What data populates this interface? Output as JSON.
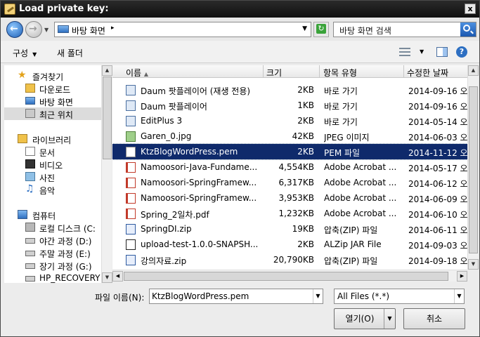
{
  "window": {
    "title": "Load private key:",
    "close_label": "x"
  },
  "address": {
    "path": "바탕 화면",
    "separator": "▸",
    "search_placeholder": "바탕 화면 검색"
  },
  "toolbar": {
    "organize": "구성",
    "new_folder": "새 폴더"
  },
  "nav": {
    "favorites": "즐겨찾기",
    "downloads": "다운로드",
    "desktop": "바탕 화면",
    "recent": "최근 위치",
    "libraries": "라이브러리",
    "documents": "문서",
    "videos": "비디오",
    "pictures": "사진",
    "music": "음악",
    "computer": "컴퓨터",
    "local_disk": "로컬 디스크 (C:",
    "drive_d": "야간 과정 (D:)",
    "drive_e": "주말 과정 (E:)",
    "drive_g": "장기 과정 (G:)",
    "drive_hp": "HP_RECOVERY"
  },
  "columns": {
    "name": "이름",
    "size": "크기",
    "type": "항목 유형",
    "date": "수정한 날짜"
  },
  "files": [
    {
      "name": "Daum 팟플레이어 (재생 전용)",
      "size": "2KB",
      "type": "바로 가기",
      "date": "2014-09-16 오후",
      "icon": "shortcut-icon"
    },
    {
      "name": "Daum 팟플레이어",
      "size": "1KB",
      "type": "바로 가기",
      "date": "2014-09-16 오후",
      "icon": "shortcut-icon"
    },
    {
      "name": "EditPlus 3",
      "size": "2KB",
      "type": "바로 가기",
      "date": "2014-05-14 오전",
      "icon": "shortcut-icon"
    },
    {
      "name": "Garen_0.jpg",
      "size": "42KB",
      "type": "JPEG 이미지",
      "date": "2014-06-03 오전",
      "icon": "image-icon"
    },
    {
      "name": "KtzBlogWordPress.pem",
      "size": "2KB",
      "type": "PEM 파일",
      "date": "2014-11-12 오전",
      "icon": "file-icon"
    },
    {
      "name": "Namoosori-Java-Fundame...",
      "size": "4,554KB",
      "type": "Adobe Acrobat ...",
      "date": "2014-05-17 오전",
      "icon": "pdf-icon"
    },
    {
      "name": "Namoosori-SpringFramew...",
      "size": "6,317KB",
      "type": "Adobe Acrobat ...",
      "date": "2014-06-12 오후",
      "icon": "pdf-icon"
    },
    {
      "name": "Namoosori-SpringFramew...",
      "size": "3,953KB",
      "type": "Adobe Acrobat ...",
      "date": "2014-06-09 오전",
      "icon": "pdf-icon"
    },
    {
      "name": "Spring_2일차.pdf",
      "size": "1,232KB",
      "type": "Adobe Acrobat ...",
      "date": "2014-06-10 오전",
      "icon": "pdf-icon"
    },
    {
      "name": "SpringDI.zip",
      "size": "19KB",
      "type": "압축(ZIP) 파일",
      "date": "2014-06-11 오전",
      "icon": "zip-icon"
    },
    {
      "name": "upload-test-1.0.0-SNAPSH...",
      "size": "2KB",
      "type": "ALZip JAR File",
      "date": "2014-09-03 오후",
      "icon": "jar-icon"
    },
    {
      "name": "강의자료.zip",
      "size": "20,790KB",
      "type": "압축(ZIP) 파일",
      "date": "2014-09-18 오후",
      "icon": "zip-icon"
    }
  ],
  "selected_file_index": 4,
  "bottom": {
    "filename_label": "파일 이름(N):",
    "filename_value": "KtzBlogWordPress.pem",
    "filetype_value": "All Files (*.*)",
    "open_label": "열기(O)",
    "cancel_label": "취소"
  }
}
